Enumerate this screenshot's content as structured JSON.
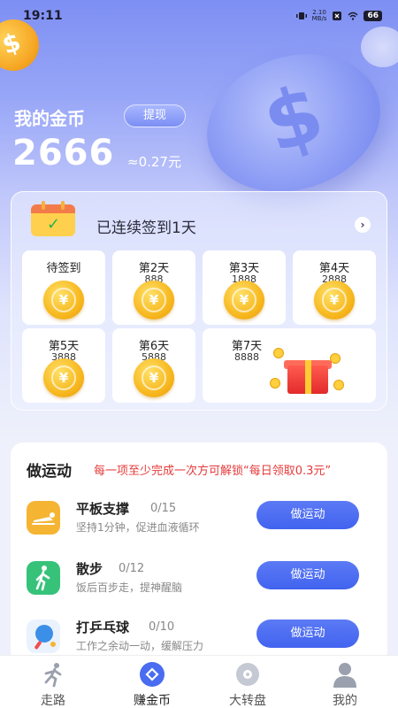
{
  "status_bar": {
    "time": "19:11",
    "net_speed_value": "2.10",
    "net_speed_unit": "MB/s",
    "battery": "66"
  },
  "header": {
    "my_coins_label": "我的金币",
    "withdraw_label": "提现",
    "coin_count": "2666",
    "coin_value": "≈0.27元"
  },
  "checkin": {
    "streak_text": "已连续签到1天",
    "days": [
      {
        "title": "待签到",
        "amount": ""
      },
      {
        "title": "第2天",
        "amount": "888"
      },
      {
        "title": "第3天",
        "amount": "1888"
      },
      {
        "title": "第4天",
        "amount": "2888"
      },
      {
        "title": "第5天",
        "amount": "3888"
      },
      {
        "title": "第6天",
        "amount": "5888"
      },
      {
        "title": "第7天",
        "amount": "8888"
      }
    ],
    "coin_symbol": "¥"
  },
  "exercise": {
    "title": "做运动",
    "note": "每一项至少完成一次方可解锁“每日领取0.3元”",
    "items": [
      {
        "name": "平板支撑",
        "progress": "0/15",
        "desc": "坚持1分钟，促进血液循环",
        "button": "做运动",
        "icon": "plank-icon",
        "color": "#f5b432"
      },
      {
        "name": "散步",
        "progress": "0/12",
        "desc": "饭后百步走，提神醒脑",
        "button": "做运动",
        "icon": "walking-icon",
        "color": "#37c27a"
      },
      {
        "name": "打乒乓球",
        "progress": "0/10",
        "desc": "工作之余动一动，缓解压力",
        "button": "做运动",
        "icon": "ping-pong-icon",
        "color": "#3b8fe6"
      }
    ]
  },
  "bottom_nav": {
    "items": [
      {
        "label": "走路",
        "icon": "running-icon"
      },
      {
        "label": "赚金币",
        "icon": "coin-icon"
      },
      {
        "label": "大转盘",
        "icon": "wheel-icon"
      },
      {
        "label": "我的",
        "icon": "profile-icon"
      }
    ]
  },
  "colors": {
    "accent": "#4a6cf0",
    "coin_gold": "#f7b81f",
    "warning_red": "#e63a3a"
  }
}
